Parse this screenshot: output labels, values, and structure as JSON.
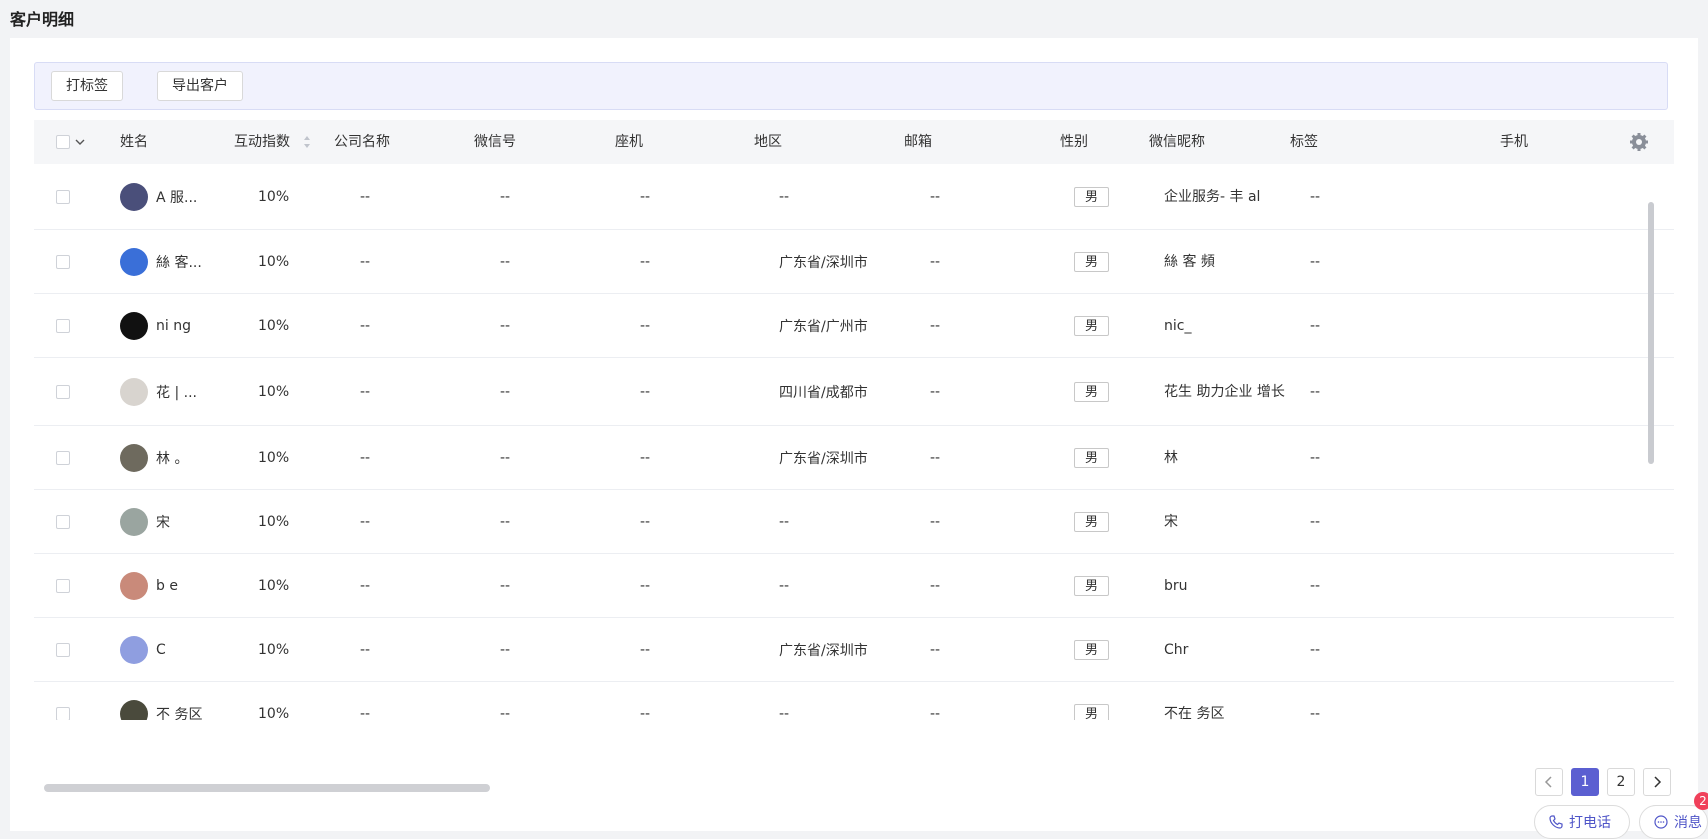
{
  "page": {
    "title": "客户明细"
  },
  "toolbar": {
    "tag_label": "打标签",
    "export_label": "导出客户"
  },
  "table": {
    "columns": [
      "姓名",
      "互动指数",
      "公司名称",
      "微信号",
      "座机",
      "地区",
      "邮箱",
      "性别",
      "微信昵称",
      "标签",
      "手机"
    ],
    "rows": [
      {
        "name": "A    服...",
        "score": "10%",
        "company": "--",
        "wechat": "--",
        "phone": "--",
        "region": "--",
        "email": "--",
        "sex": "男",
        "nickname": "企业服务-    丰 al",
        "tag": "--",
        "avatar": "#4a4f7a"
      },
      {
        "name": "絲   客...",
        "score": "10%",
        "company": "--",
        "wechat": "--",
        "phone": "--",
        "region": "广东省/深圳市",
        "email": "--",
        "sex": "男",
        "nickname": "絲  客  頻",
        "tag": "--",
        "avatar": "#3a6fd8"
      },
      {
        "name": "ni   ng",
        "score": "10%",
        "company": "--",
        "wechat": "--",
        "phone": "--",
        "region": "广东省/广州市",
        "email": "--",
        "sex": "男",
        "nickname": "nic_",
        "tag": "--",
        "avatar": "#111111"
      },
      {
        "name": "花   | ...",
        "score": "10%",
        "company": "--",
        "wechat": "--",
        "phone": "--",
        "region": "四川省/成都市",
        "email": "--",
        "sex": "男",
        "nickname": "花生   助力企业 增长",
        "tag": "--",
        "avatar": "#d8d4cf"
      },
      {
        "name": "林   。",
        "score": "10%",
        "company": "--",
        "wechat": "--",
        "phone": "--",
        "region": "广东省/深圳市",
        "email": "--",
        "sex": "男",
        "nickname": "林",
        "tag": "--",
        "avatar": "#6e6a5e"
      },
      {
        "name": "宋",
        "score": "10%",
        "company": "--",
        "wechat": "--",
        "phone": "--",
        "region": "--",
        "email": "--",
        "sex": "男",
        "nickname": "宋",
        "tag": "--",
        "avatar": "#9aa5a0"
      },
      {
        "name": "b   e",
        "score": "10%",
        "company": "--",
        "wechat": "--",
        "phone": "--",
        "region": "--",
        "email": "--",
        "sex": "男",
        "nickname": "bru",
        "tag": "--",
        "avatar": "#c98a7a"
      },
      {
        "name": "C",
        "score": "10%",
        "company": "--",
        "wechat": "--",
        "phone": "--",
        "region": "广东省/深圳市",
        "email": "--",
        "sex": "男",
        "nickname": "Chr",
        "tag": "--",
        "avatar": "#8f9ee0"
      },
      {
        "name": "不   务区",
        "score": "10%",
        "company": "--",
        "wechat": "--",
        "phone": "--",
        "region": "--",
        "email": "--",
        "sex": "男",
        "nickname": "不在  务区",
        "tag": "--",
        "avatar": "#4a4a3c"
      }
    ]
  },
  "pagination": {
    "pages": [
      "1",
      "2"
    ],
    "current": "1"
  },
  "float": {
    "call_label": "打电话",
    "msg_label": "消息",
    "msg_badge": "2"
  }
}
